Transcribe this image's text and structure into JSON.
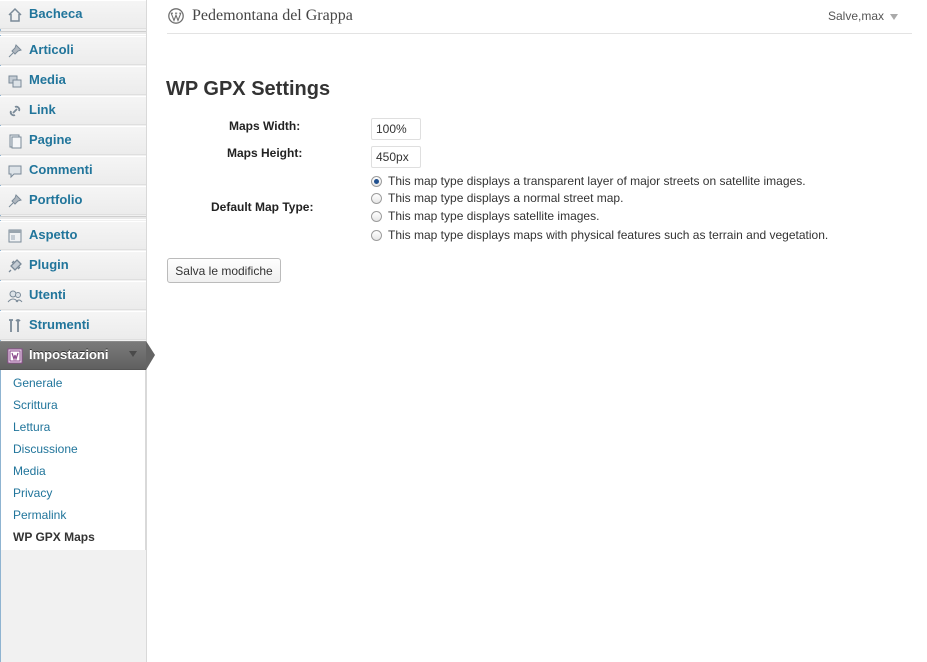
{
  "sidebar": {
    "items": [
      {
        "label": "Bacheca",
        "icon": "dashboard-icon"
      },
      {
        "label": "Articoli",
        "icon": "pushpin-icon"
      },
      {
        "label": "Media",
        "icon": "media-icon"
      },
      {
        "label": "Link",
        "icon": "link-icon"
      },
      {
        "label": "Pagine",
        "icon": "pages-icon"
      },
      {
        "label": "Commenti",
        "icon": "comment-icon"
      },
      {
        "label": "Portfolio",
        "icon": "pushpin-icon"
      },
      {
        "label": "Aspetto",
        "icon": "appearance-icon"
      },
      {
        "label": "Plugin",
        "icon": "plugin-icon"
      },
      {
        "label": "Utenti",
        "icon": "users-icon"
      },
      {
        "label": "Strumenti",
        "icon": "tools-icon"
      },
      {
        "label": "Impostazioni",
        "icon": "settings-icon",
        "active": true
      }
    ],
    "submenu": [
      {
        "label": "Generale"
      },
      {
        "label": "Scrittura"
      },
      {
        "label": "Lettura"
      },
      {
        "label": "Discussione"
      },
      {
        "label": "Media"
      },
      {
        "label": "Privacy"
      },
      {
        "label": "Permalink"
      },
      {
        "label": "WP GPX Maps",
        "current": true
      }
    ]
  },
  "header": {
    "site_title": "Pedemontana del Grappa",
    "user_greeting": "Salve,max"
  },
  "main": {
    "title": "WP GPX Settings",
    "fields": {
      "maps_width": {
        "label": "Maps Width:",
        "value": "100%"
      },
      "maps_height": {
        "label": "Maps Height:",
        "value": "450px"
      },
      "map_type": {
        "label": "Default Map Type:",
        "selected_index": 0,
        "options": [
          "This map type displays a transparent layer of major streets on satellite images.",
          "This map type displays a normal street map.",
          "This map type displays satellite images.",
          "This map type displays maps with physical features such as terrain and vegetation."
        ]
      }
    },
    "save_label": "Salva le modifiche"
  },
  "colors": {
    "link": "#21759b",
    "active_menu": "#6d6d6d",
    "radio_checked": "#20508f"
  }
}
